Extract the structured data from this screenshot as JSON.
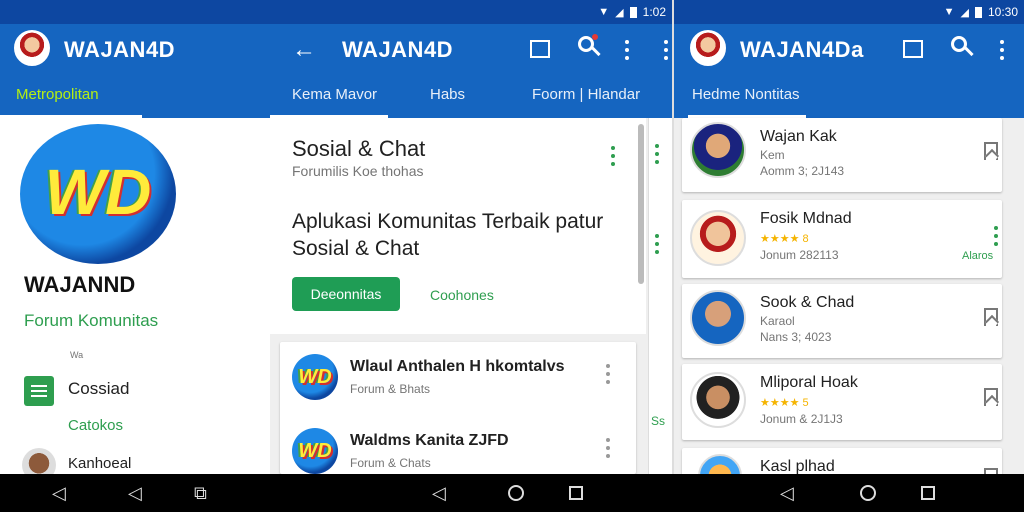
{
  "status": {
    "time_1": "1:02",
    "time_2": "10:30"
  },
  "screen1": {
    "app_title": "WAJAN4D",
    "tab_active": "Metropolitan",
    "logo_text": "WD",
    "brand_name": "WAJANND",
    "brand_subtitle": "Forum Komunitas",
    "small_label": "Wa",
    "item1_label": "Cossiad",
    "item1_sub": "Catokos",
    "item2_label": "Kanhoeal"
  },
  "screen2": {
    "app_title": "WAJAN4D",
    "tabs": [
      "Kema Mavor",
      "Habs",
      "Foorm | Hlandar"
    ],
    "card_title": "Sosial & Chat",
    "card_subtitle": "Forumilis Koe thohas",
    "headline": "Aplukasi Komunitas Terbaik patur Sosial & Chat",
    "primary_button": "Deeonnitas",
    "secondary_button": "Coohones",
    "list": [
      {
        "title": "Wlaul Anthalen H hkomtalvs",
        "subtitle": "Forum & Bhats"
      },
      {
        "title": "Waldms Kanita ZJFD",
        "subtitle": "Forum & Chats"
      }
    ],
    "edge_label": "Ss"
  },
  "screen3": {
    "app_title": "WAJAN4Da",
    "tab_active": "Hedme Nontitas",
    "list": [
      {
        "title": "Wajan Kak",
        "line1": "Kem",
        "line2": "Aomm 3; 2J143",
        "rating": ""
      },
      {
        "title": "Fosik Mdnad",
        "line1": "",
        "line2": "Jonum 282113",
        "rating": "★★★★ 8",
        "action": "Alaros"
      },
      {
        "title": "Sook & Chad",
        "line1": "Karaol",
        "line2": "Nans 3; 4023",
        "rating": ""
      },
      {
        "title": "Mliporal Hoak",
        "line1": "",
        "line2": "Jonum & 2J1J3",
        "rating": "★★★★ 5"
      },
      {
        "title": "Kasl plhad",
        "line1": "",
        "line2": "",
        "rating": ""
      }
    ]
  },
  "colors": {
    "statusbar": "#0d47a1",
    "appbar": "#1565c0",
    "accent_green": "#1f9d55",
    "tab_active": "#c6ff00"
  }
}
